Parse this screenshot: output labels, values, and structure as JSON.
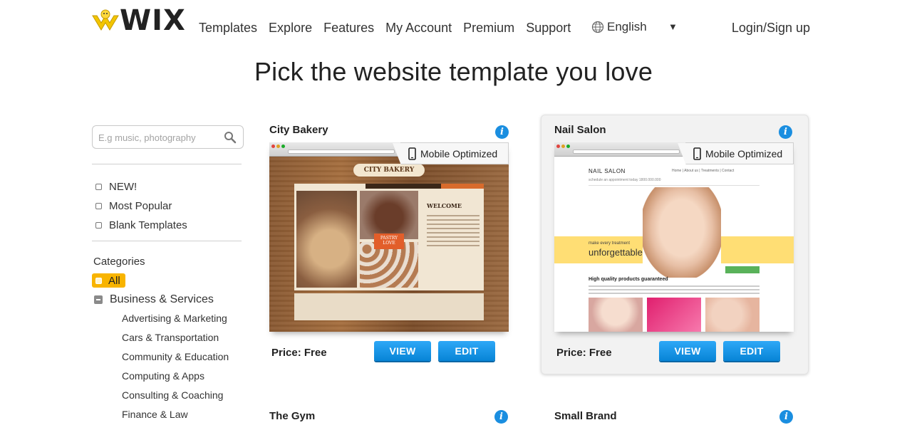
{
  "header": {
    "logo_text": "WIX",
    "nav": [
      "Templates",
      "Explore",
      "Features",
      "My Account",
      "Premium",
      "Support"
    ],
    "language": "English",
    "language_caret": "▼",
    "login": "Login/Sign up"
  },
  "page_title": "Pick the website template you love",
  "sidebar": {
    "search_placeholder": "E.g music, photography",
    "filters": [
      "NEW!",
      "Most Popular",
      "Blank Templates"
    ],
    "categories_title": "Categories",
    "category_all": "All",
    "category_business": "Business & Services",
    "subcategories": [
      "Advertising & Marketing",
      "Cars & Transportation",
      "Community & Education",
      "Computing & Apps",
      "Consulting & Coaching",
      "Finance & Law"
    ]
  },
  "templates": [
    {
      "title": "City Bakery",
      "mobile_label": "Mobile Optimized",
      "price": "Price: Free",
      "view": "VIEW",
      "edit": "EDIT",
      "preview": {
        "banner": "CITY BAKERY",
        "badge": "PASTRY LOVE",
        "heading": "WELCOME"
      }
    },
    {
      "title": "Nail Salon",
      "mobile_label": "Mobile Optimized",
      "price": "Price: Free",
      "view": "VIEW",
      "edit": "EDIT",
      "preview": {
        "brand": "NAIL SALON",
        "tagline": "schedule an appointment today 1800.000.000",
        "nav": "Home  |  About us  |  Treatments  |  Contact",
        "band_small": "make every treatment",
        "band_big": "unforgettable",
        "heading": "High quality products guaranteed"
      }
    },
    {
      "title": "The Gym"
    },
    {
      "title": "Small Brand"
    }
  ],
  "info_glyph": "i",
  "colors": {
    "accent_blue": "#1a8ee0",
    "button_blue": "#0784d6",
    "category_selected": "#f8b400"
  }
}
